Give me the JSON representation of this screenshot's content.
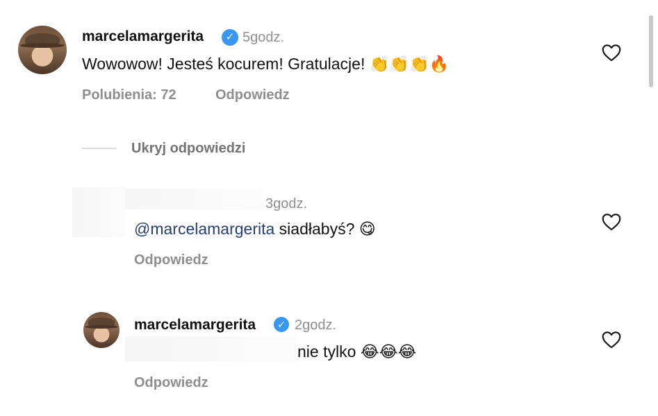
{
  "comment": {
    "username": "marcelamargerita",
    "time": "5godz.",
    "text": "Wowowow! Jesteś kocurem! Gratulacje!",
    "emoji": "👏👏👏🔥",
    "likes": "Polubienia: 72",
    "reply_label": "Odpowiedz"
  },
  "hide_replies_label": "Ukryj odpowiedzi",
  "reply1": {
    "time": "3godz.",
    "mention": "@marcelamargerita",
    "text": " siadłabyś?",
    "emoji": "😋",
    "reply_label": "Odpowiedz"
  },
  "reply2": {
    "username": "marcelamargerita",
    "time": "2godz.",
    "text": "nie tylko",
    "emoji": "😂😂😂",
    "reply_label": "Odpowiedz"
  },
  "icons": {
    "verified": "verified-badge-icon",
    "heart": "heart-outline-icon"
  },
  "colors": {
    "verified": "#3897f0",
    "mention": "#243f73",
    "muted": "#8e8e8e"
  }
}
